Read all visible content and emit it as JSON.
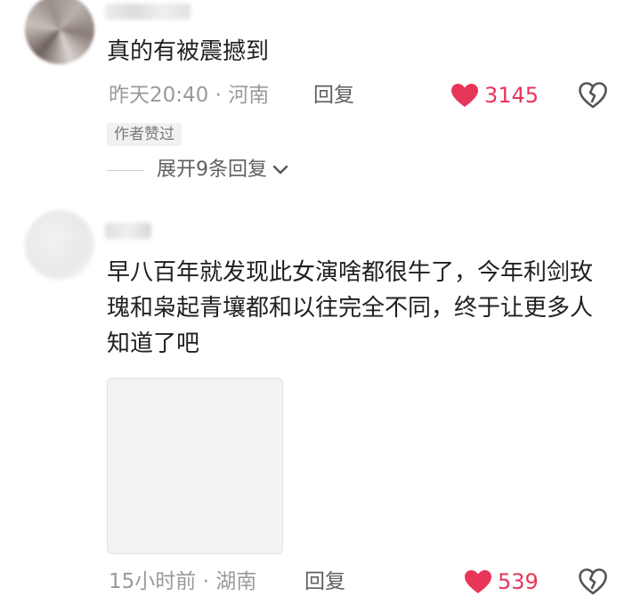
{
  "comments": [
    {
      "text": "真的有被震撼到",
      "meta": "昨天20:40 · 河南",
      "reply_label": "回复",
      "likes": "3145",
      "badge": "作者赞过",
      "expand_label": "展开9条回复"
    },
    {
      "text": "早八百年就发现此女演啥都很牛了，今年利剑玫瑰和枭起青壤都和以往完全不同，终于让更多人知道了吧",
      "meta": "15小时前 · 湖南",
      "reply_label": "回复",
      "likes": "539"
    }
  ],
  "colors": {
    "like": "#e8365a",
    "meta": "#9a9a9a",
    "text": "#1f1f1f"
  },
  "icons": {
    "like": "heart-icon",
    "dislike": "broken-heart-icon",
    "expand": "chevron-down-icon"
  }
}
